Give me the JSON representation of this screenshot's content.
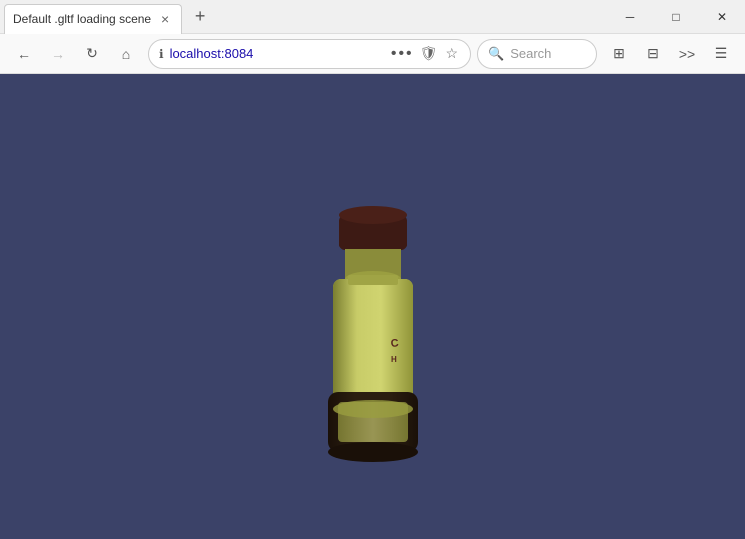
{
  "titlebar": {
    "tab_title": "Default .gltf loading scene",
    "close_label": "×",
    "new_tab_label": "+",
    "minimize_label": "─",
    "maximize_label": "□",
    "winclose_label": "✕"
  },
  "navbar": {
    "back_label": "←",
    "forward_label": "→",
    "refresh_label": "↻",
    "home_label": "⌂",
    "url": "localhost:8084",
    "dots_label": "•••",
    "search_placeholder": "Search"
  },
  "viewport": {
    "bg_color": "#3b4268"
  }
}
